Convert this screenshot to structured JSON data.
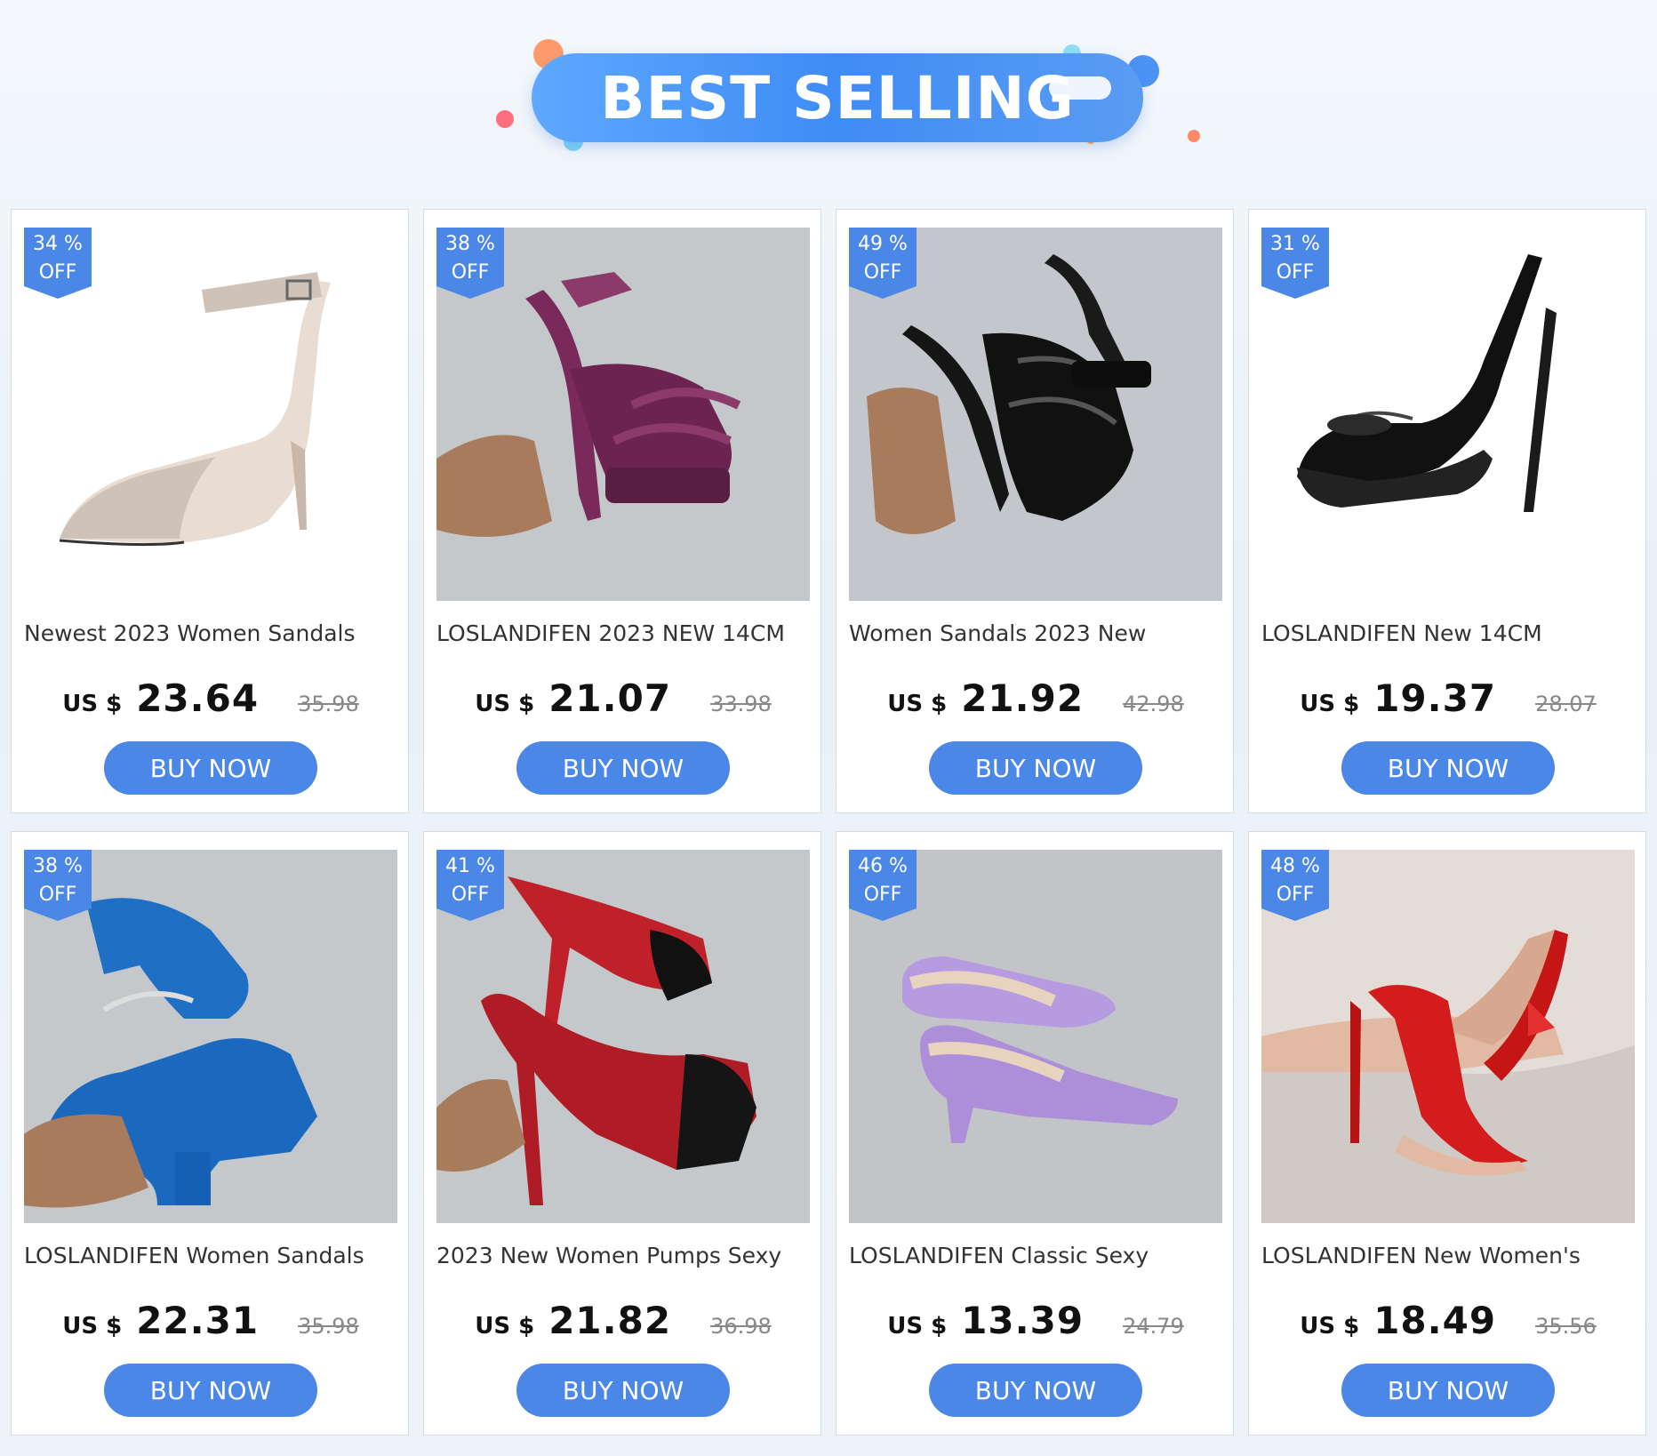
{
  "banner": {
    "title": "BEST SELLING"
  },
  "colors": {
    "accent": "#4a87e6",
    "badge": "#4a87e6",
    "banner": "#3f8cf5"
  },
  "products": [
    {
      "discount": "34 %",
      "off": "OFF",
      "title": "Newest 2023 Women Sandals",
      "currency": "US $",
      "price": "23.64",
      "old_price": "35.98",
      "button": "BUY NOW",
      "image": "nude-suede-ankle-strap-pump"
    },
    {
      "discount": "38 %",
      "off": "OFF",
      "title": "LOSLANDIFEN 2023 NEW 14CM",
      "currency": "US $",
      "price": "21.07",
      "old_price": "33.98",
      "button": "BUY NOW",
      "image": "purple-snake-platform-sandal"
    },
    {
      "discount": "49 %",
      "off": "OFF",
      "title": "Women Sandals 2023 New",
      "currency": "US $",
      "price": "21.92",
      "old_price": "42.98",
      "button": "BUY NOW",
      "image": "black-strappy-platform-sandal"
    },
    {
      "discount": "31 %",
      "off": "OFF",
      "title": "LOSLANDIFEN New 14CM",
      "currency": "US $",
      "price": "19.37",
      "old_price": "28.07",
      "button": "BUY NOW",
      "image": "black-patent-slingback-peeptoe"
    },
    {
      "discount": "38 %",
      "off": "OFF",
      "title": "LOSLANDIFEN Women Sandals",
      "currency": "US $",
      "price": "22.31",
      "old_price": "35.98",
      "button": "BUY NOW",
      "image": "blue-block-heel-sandal"
    },
    {
      "discount": "41 %",
      "off": "OFF",
      "title": "2023 New Women Pumps Sexy",
      "currency": "US $",
      "price": "21.82",
      "old_price": "36.98",
      "button": "BUY NOW",
      "image": "red-black-gradient-peeptoe-pump"
    },
    {
      "discount": "46 %",
      "off": "OFF",
      "title": "LOSLANDIFEN Classic Sexy",
      "currency": "US $",
      "price": "13.39",
      "old_price": "24.79",
      "button": "BUY NOW",
      "image": "lilac-patent-kitten-heel-pump"
    },
    {
      "discount": "48 %",
      "off": "OFF",
      "title": "LOSLANDIFEN New Women's",
      "currency": "US $",
      "price": "18.49",
      "old_price": "35.56",
      "button": "BUY NOW",
      "image": "red-patent-stiletto-pump"
    }
  ]
}
